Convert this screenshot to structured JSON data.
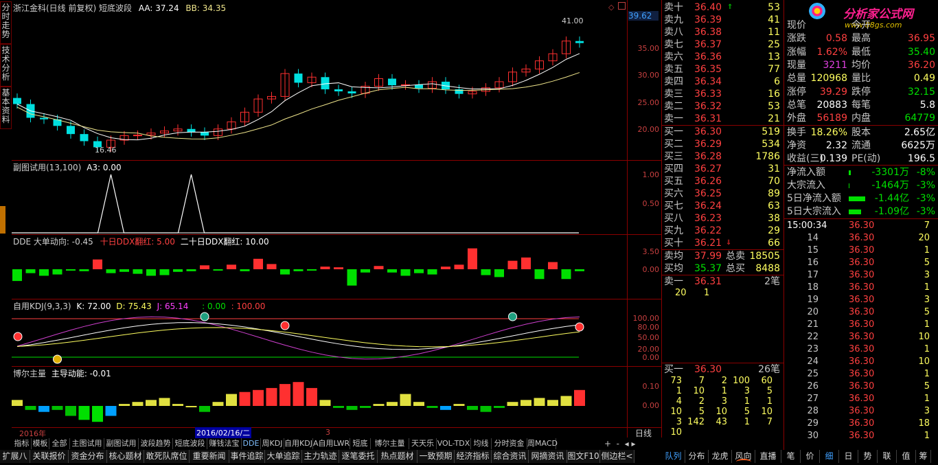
{
  "colors": {
    "up": "#ff3030",
    "down": "#00e0e0",
    "ma1": "#ffffff",
    "ma2": "#f0e68c",
    "grid": "#8b0000",
    "price": "#ff4040",
    "vol": "#ffff60",
    "green": "#00e000"
  },
  "sidebar_tabs": [
    "分时走势",
    "技术分析",
    "基本资料"
  ],
  "main": {
    "title": "浙江金科(日线 前复权) 短底波段",
    "aa": "AA: 37.24",
    "bb": "BB: 34.35",
    "price_tag": "39.62",
    "high_label": "41.00",
    "low_label": "16.46",
    "yaxis": [
      "35.00",
      "30.00",
      "25.00",
      "20.00"
    ]
  },
  "sub1": {
    "title": "副图试用(13,100)",
    "a3": "A3: 0.00",
    "yaxis": [
      "1.00",
      "0.50"
    ],
    "peaks": [
      7,
      13
    ]
  },
  "dde": {
    "title": "DDE 大单动向: -0.45",
    "ten": "十日DDX翻红: 5.00",
    "twenty": "二十日DDX翻红: 10.00",
    "yaxis": [
      "3.50",
      "0.00"
    ],
    "values": [
      -1.8,
      -0.6,
      -1.0,
      -0.8,
      -0.2,
      -0.3,
      1.5,
      -0.6,
      -0.4,
      -0.7,
      -1.0,
      -0.9,
      -0.4,
      -0.3,
      0.6,
      -0.2,
      0.7,
      -0.3,
      1.6,
      0.8,
      -0.8,
      -0.3,
      -0.2,
      0.4,
      0.3,
      -2.5,
      -0.5,
      0.5,
      -0.5,
      -1.0,
      -0.6,
      -0.8,
      0.4,
      0.7,
      3.2,
      -0.9,
      -1.2,
      1.3,
      1.8,
      -1.5,
      1.1,
      -1.5,
      -0.3
    ]
  },
  "kdj": {
    "title": "自用KDJ(9,3,3)",
    "k": "K: 72.00",
    "d": "D: 75.43",
    "j": "J: 65.14",
    "extra1": ": 0.00",
    "extra2": ": 100.00",
    "yaxis": [
      "100.00",
      "80.00",
      "50.00",
      "20.00",
      "0.00"
    ]
  },
  "boer": {
    "title": "博尔主量",
    "main": "主导动能: -0.01",
    "yaxis": [
      "0.10",
      "0.00"
    ],
    "values": [
      0.03,
      -0.02,
      -0.03,
      -0.02,
      -0.05,
      -0.07,
      -0.08,
      -0.05,
      0.01,
      0.02,
      0.03,
      0.04,
      0.01,
      0.0,
      -0.03,
      0.02,
      0.06,
      0.07,
      0.08,
      0.09,
      0.11,
      0.12,
      0.09,
      0.03,
      -0.01,
      -0.02,
      -0.01,
      0.01,
      0.02,
      0.06,
      0.02,
      -0.01,
      -0.02,
      0.01,
      -0.02,
      -0.03,
      -0.01,
      0.02,
      0.03,
      0.04,
      0.03,
      0.05,
      0.08,
      0.04,
      0.02,
      0.0
    ]
  },
  "date_axis": {
    "year": "2016年",
    "cursor": "2016/02/16/二",
    "mark": "3",
    "mode": "日线"
  },
  "orderbook": {
    "sells": [
      {
        "label": "卖十",
        "price": "36.40",
        "vol": "53",
        "mark": "⇑"
      },
      {
        "label": "卖九",
        "price": "36.39",
        "vol": "41"
      },
      {
        "label": "卖八",
        "price": "36.38",
        "vol": "11"
      },
      {
        "label": "卖七",
        "price": "36.37",
        "vol": "25"
      },
      {
        "label": "卖六",
        "price": "36.36",
        "vol": "13"
      },
      {
        "label": "卖五",
        "price": "36.35",
        "vol": "77"
      },
      {
        "label": "卖四",
        "price": "36.34",
        "vol": "6"
      },
      {
        "label": "卖三",
        "price": "36.33",
        "vol": "16"
      },
      {
        "label": "卖二",
        "price": "36.32",
        "vol": "53"
      },
      {
        "label": "卖一",
        "price": "36.31",
        "vol": "21"
      }
    ],
    "buys": [
      {
        "label": "买一",
        "price": "36.30",
        "vol": "519"
      },
      {
        "label": "买二",
        "price": "36.29",
        "vol": "534"
      },
      {
        "label": "买三",
        "price": "36.28",
        "vol": "1786"
      },
      {
        "label": "买四",
        "price": "36.27",
        "vol": "31"
      },
      {
        "label": "买五",
        "price": "36.26",
        "vol": "70"
      },
      {
        "label": "买六",
        "price": "36.25",
        "vol": "89"
      },
      {
        "label": "买七",
        "price": "36.24",
        "vol": "63"
      },
      {
        "label": "买八",
        "price": "36.23",
        "vol": "38"
      },
      {
        "label": "买九",
        "price": "36.22",
        "vol": "29"
      },
      {
        "label": "买十",
        "price": "36.21",
        "vol": "66",
        "mark": "⇓"
      }
    ],
    "avg_sell_label": "卖均",
    "avg_sell": "37.99",
    "total_sell_label": "总卖",
    "total_sell": "18505",
    "avg_buy_label": "买均",
    "avg_buy": "35.37",
    "total_buy_label": "总买",
    "total_buy": "8488",
    "sell1": {
      "label": "卖一",
      "price": "36.31",
      "count": "2笔",
      "queue": [
        "20",
        "1"
      ]
    },
    "buy1": {
      "label": "买一",
      "price": "36.30",
      "count": "26笔",
      "queue": [
        [
          "73",
          "7",
          "2",
          "100",
          "60"
        ],
        [
          "1",
          "10",
          "1",
          "3",
          "5"
        ],
        [
          "4",
          "2",
          "3",
          "1",
          "1"
        ],
        [
          "10",
          "5",
          "10",
          "5",
          "10"
        ],
        [
          "3",
          "142",
          "43",
          "1",
          "7"
        ],
        [
          "10",
          "",
          "",
          "",
          ""
        ]
      ]
    }
  },
  "logo": {
    "title": "分析家公式网",
    "url": "www.88gs.com"
  },
  "stats": [
    {
      "l1": "现价",
      "v1": "",
      "l2": "今开",
      "v2": ""
    },
    {
      "l1": "涨跌",
      "v1": "0.58",
      "l2": "最高",
      "v2": "36.95"
    },
    {
      "l1": "涨幅",
      "v1": "1.62%",
      "l2": "最低",
      "v2": "35.40"
    },
    {
      "l1": "现量",
      "v1": "3211",
      "l2": "均价",
      "v2": "36.20"
    },
    {
      "l1": "总量",
      "v1": "120968",
      "l2": "量比",
      "v2": "0.49"
    },
    {
      "l1": "涨停",
      "v1": "39.29",
      "l2": "跌停",
      "v2": "32.15"
    },
    {
      "l1": "总笔",
      "v1": "20883",
      "l2": "每笔",
      "v2": "5.8"
    },
    {
      "l1": "外盘",
      "v1": "56189",
      "l2": "内盘",
      "v2": "64779"
    },
    {
      "l1": "换手",
      "v1": "18.26%",
      "l2": "股本",
      "v2": "2.65亿"
    },
    {
      "l1": "净资",
      "v1": "2.32",
      "l2": "流通",
      "v2": "6625万"
    },
    {
      "l1": "收益(三)",
      "v1": "0.139",
      "l2": "PE(动)",
      "v2": "196.5"
    }
  ],
  "flows": [
    {
      "label": "净流入额",
      "value": "-3301万",
      "pct": "-8%",
      "bar": 3
    },
    {
      "label": "大宗流入",
      "value": "-1464万",
      "pct": "-3%",
      "bar": 1
    },
    {
      "label": "5日净流入额",
      "value": "-1.44亿",
      "pct": "-3%",
      "bar": 24
    },
    {
      "label": "5日大宗流入",
      "value": "-1.09亿",
      "pct": "-3%",
      "bar": 18
    }
  ],
  "ticks": [
    {
      "time": "15:00:34",
      "price": "36.30",
      "vol": "7"
    },
    {
      "time": "14",
      "price": "36.30",
      "vol": "20"
    },
    {
      "time": "15",
      "price": "36.30",
      "vol": "1"
    },
    {
      "time": "16",
      "price": "36.30",
      "vol": "5"
    },
    {
      "time": "17",
      "price": "36.30",
      "vol": "3"
    },
    {
      "time": "18",
      "price": "36.30",
      "vol": "1"
    },
    {
      "time": "19",
      "price": "36.30",
      "vol": "3"
    },
    {
      "time": "20",
      "price": "36.30",
      "vol": "5"
    },
    {
      "time": "21",
      "price": "36.30",
      "vol": "1"
    },
    {
      "time": "22",
      "price": "36.30",
      "vol": "10"
    },
    {
      "time": "23",
      "price": "36.30",
      "vol": "1"
    },
    {
      "time": "24",
      "price": "36.30",
      "vol": "10"
    },
    {
      "time": "25",
      "price": "36.30",
      "vol": "1"
    },
    {
      "time": "26",
      "price": "36.30",
      "vol": "5"
    },
    {
      "time": "27",
      "price": "36.30",
      "vol": "1"
    },
    {
      "time": "28",
      "price": "36.30",
      "vol": "3"
    },
    {
      "time": "29",
      "price": "36.30",
      "vol": "18"
    },
    {
      "time": "30",
      "price": "36.30",
      "vol": "1"
    }
  ],
  "indicator_tabs": [
    "指标",
    "模板",
    "全部",
    "主图试用",
    "副图试用",
    "波段趋势",
    "短底波段",
    "赚钱法宝",
    "DDE",
    "周KDJ",
    "自用KDJ",
    "A自用LWR",
    "短底",
    "博尔主量",
    "天天乐",
    "VOL-TDX",
    "均线",
    "分时资金",
    "周MACD"
  ],
  "nav_tabs": [
    "扩展八",
    "关联报价",
    "资金分布",
    "核心题材",
    "敢死队席位",
    "重要新闻",
    "事件追踪",
    "大单追踪",
    "主力轨迹",
    "逐笔委托",
    "热点题材",
    "一致预期",
    "经济指标",
    "综合资讯",
    "网摘资讯",
    "图文F10",
    "侧边栏<"
  ],
  "right_tabs": [
    "队列",
    "分布",
    "龙虎",
    "风向",
    "直播",
    "笔",
    "价",
    "细",
    "日",
    "势",
    "联",
    "值",
    "筹"
  ]
}
